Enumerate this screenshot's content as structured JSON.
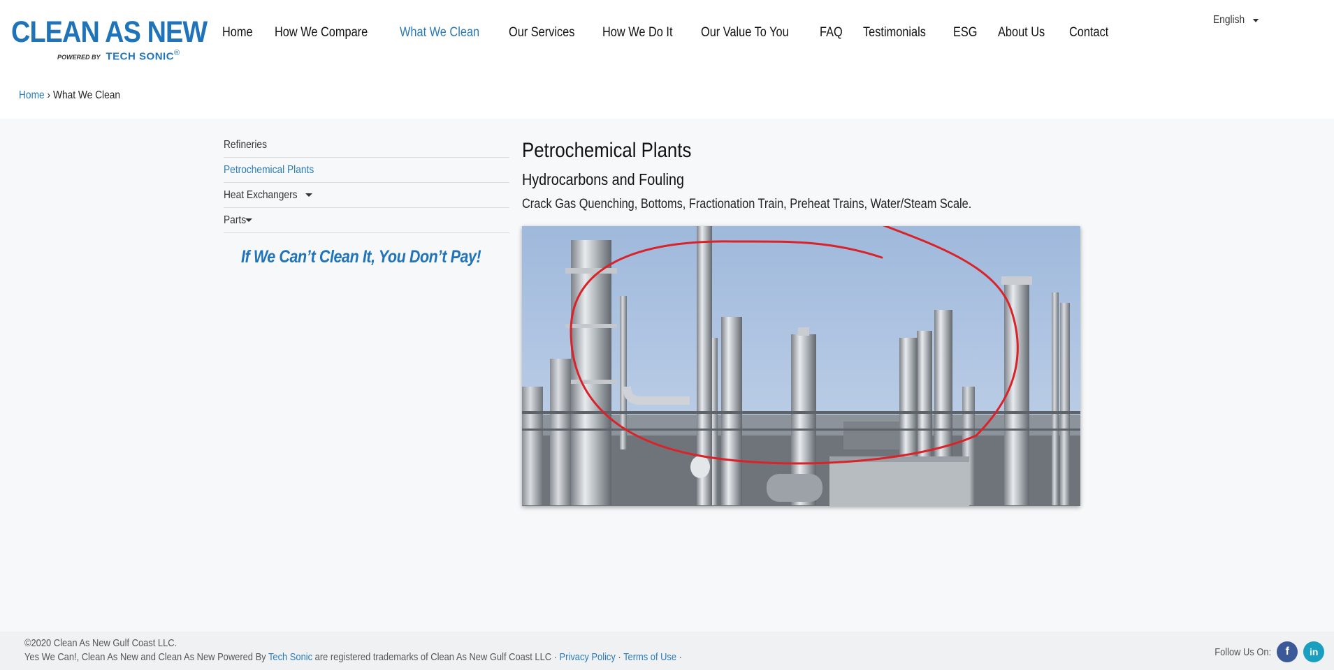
{
  "logo": {
    "main": "CLEAN AS NEW",
    "powered": "POWERED BY",
    "tech": "TECH SONIC",
    "reg": "®"
  },
  "nav": {
    "items": [
      {
        "label": "Home"
      },
      {
        "label": "How We Compare"
      },
      {
        "label": "What We Clean",
        "active": true
      },
      {
        "label": "Our Services"
      },
      {
        "label": "How We Do It"
      },
      {
        "label": "Our Value To You"
      },
      {
        "label": "FAQ"
      },
      {
        "label": "Testimonials"
      },
      {
        "label": "ESG"
      },
      {
        "label": "About Us"
      },
      {
        "label": "Contact"
      }
    ]
  },
  "language": {
    "selected": "English"
  },
  "breadcrumb": {
    "home": "Home",
    "separator": "›",
    "current": "What We Clean"
  },
  "sidebar": {
    "items": [
      {
        "label": "Refineries"
      },
      {
        "label": "Petrochemical Plants",
        "active": true
      },
      {
        "label": "Heat Exchangers",
        "dropdown": true
      },
      {
        "label": "Parts",
        "dropdown": true
      }
    ],
    "slogan": "If We Can’t Clean It, You Don’t Pay!"
  },
  "content": {
    "title": "Petrochemical Plants",
    "subtitle": "Hydrocarbons and Fouling",
    "description": "Crack Gas Quenching, Bottoms, Fractionation Train, Preheat Trains, Water/Steam Scale."
  },
  "footer": {
    "copyright": "©2020 Clean As New Gulf Coast LLC.",
    "trademark_pre": "Yes We Can!, Clean As New and Clean As New Powered By ",
    "trademark_link": "Tech Sonic",
    "trademark_post": " are registered trademarks of Clean As New Gulf Coast LLC · ",
    "privacy": "Privacy Policy",
    "sep": " · ",
    "terms": "Terms of Use",
    "trail": " ·",
    "follow": "Follow Us On:",
    "facebook_glyph": "f",
    "linkedin_glyph": "in"
  },
  "colors": {
    "brand": "#1f73b8",
    "link": "#2a7ab8",
    "annotation": "#d8232a"
  }
}
